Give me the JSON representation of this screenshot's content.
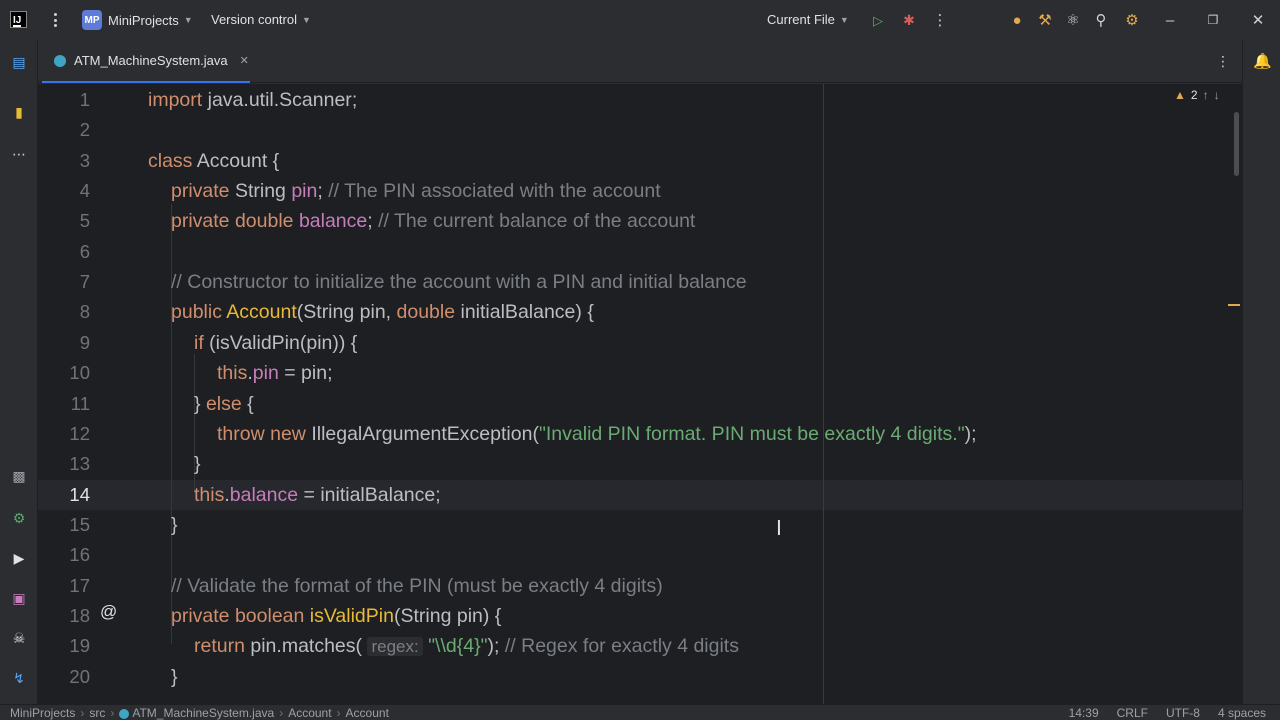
{
  "titlebar": {
    "logo": "IJ",
    "project_badge": "MP",
    "project_name": "MiniProjects",
    "vcs_label": "Version control",
    "run_config": "Current File"
  },
  "tab": {
    "file_name": "ATM_MachineSystem.java"
  },
  "inspection": {
    "warnings": "2"
  },
  "code_lines": [
    "import java.util.Scanner;",
    "",
    "class Account {",
    "private String pin; // The PIN associated with the account",
    "private double balance; // The current balance of the account",
    "",
    "// Constructor to initialize the account with a PIN and initial balance",
    "public Account(String pin, double initialBalance) {",
    "if (isValidPin(pin)) {",
    "this.pin = pin;",
    "} else {",
    "throw new IllegalArgumentException(\"Invalid PIN format. PIN must be exactly 4 digits.\");",
    "}",
    "this.balance = initialBalance;",
    "}",
    "",
    "// Validate the format of the PIN (must be exactly 4 digits)",
    "private boolean isValidPin(String pin) {",
    "return pin.matches( regex: \"\\\\d{4}\"); // Regex for exactly 4 digits",
    "}"
  ],
  "line_numbers": [
    "1",
    "2",
    "3",
    "4",
    "5",
    "6",
    "7",
    "8",
    "9",
    "10",
    "11",
    "12",
    "13",
    "14",
    "15",
    "16",
    "17",
    "18",
    "19",
    "20"
  ],
  "current_line": 14,
  "statusbar": {
    "breadcrumbs": [
      "MiniProjects",
      "src",
      "ATM_MachineSystem.java",
      "Account",
      "Account"
    ],
    "position": "14:39",
    "line_sep": "CRLF",
    "encoding": "UTF-8",
    "indent": "4 spaces"
  },
  "colors": {
    "keyword": "#cf8e6d",
    "field": "#c77dbb",
    "string": "#6aab73",
    "comment": "#7a7e85",
    "method_decl": "#e8ba36",
    "accent": "#3574f0"
  },
  "icons": [
    "run-icon",
    "debug-icon",
    "search-icon",
    "settings-icon",
    "bell-icon",
    "override-icon"
  ]
}
